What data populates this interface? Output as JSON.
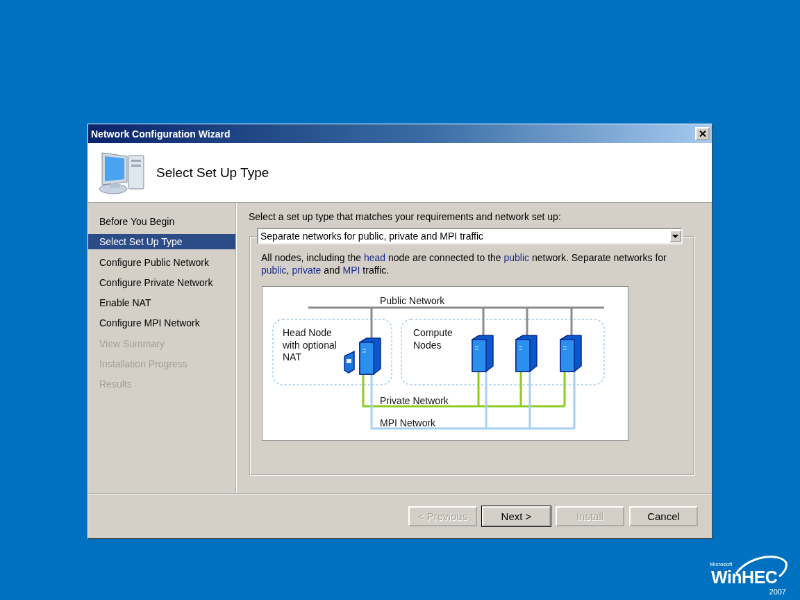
{
  "window": {
    "title": "Network Configuration Wizard",
    "header": {
      "title": "Select Set Up Type"
    },
    "steps": [
      {
        "label": "Before You Begin",
        "selected": false,
        "disabled": false
      },
      {
        "label": "Select Set Up Type",
        "selected": true,
        "disabled": false
      },
      {
        "label": "Configure Public Network",
        "selected": false,
        "disabled": false
      },
      {
        "label": "Configure Private Network",
        "selected": false,
        "disabled": false
      },
      {
        "label": "Enable NAT",
        "selected": false,
        "disabled": false
      },
      {
        "label": "Configure MPI Network",
        "selected": false,
        "disabled": false
      },
      {
        "label": "View Summary",
        "selected": false,
        "disabled": true
      },
      {
        "label": "Installation Progress",
        "selected": false,
        "disabled": true
      },
      {
        "label": "Results",
        "selected": false,
        "disabled": true
      }
    ],
    "prompt": "Select a set up type that matches your requirements and network set up:",
    "setup_type": {
      "value": "Separate networks for public, private and MPI traffic"
    },
    "description": [
      {
        "text": "All nodes, including the ",
        "kind": "plain"
      },
      {
        "text": "head",
        "kind": "term"
      },
      {
        "text": " node are connected to the ",
        "kind": "plain"
      },
      {
        "text": "public",
        "kind": "term"
      },
      {
        "text": " network. Separate networks for ",
        "kind": "plain"
      },
      {
        "text": "public",
        "kind": "term"
      },
      {
        "text": ", ",
        "kind": "plain"
      },
      {
        "text": "private",
        "kind": "term"
      },
      {
        "text": " and ",
        "kind": "plain"
      },
      {
        "text": "MPI",
        "kind": "term"
      },
      {
        "text": " traffic.",
        "kind": "plain"
      }
    ],
    "diagram": {
      "public_label": "Public Network",
      "head_label": [
        "Head Node",
        "with optional",
        "NAT"
      ],
      "compute_label": [
        "Compute",
        "Nodes"
      ],
      "private_label": "Private Network",
      "mpi_label": "MPI Network"
    },
    "buttons": [
      {
        "label": "< Previous",
        "disabled": true,
        "default": false
      },
      {
        "label": "Next >",
        "disabled": false,
        "default": true
      },
      {
        "label": "Install",
        "disabled": true,
        "default": false
      },
      {
        "label": "Cancel",
        "disabled": false,
        "default": false
      }
    ]
  },
  "logo": {
    "brand": "Microsoft",
    "name": "WinHEC",
    "year": "2007"
  }
}
